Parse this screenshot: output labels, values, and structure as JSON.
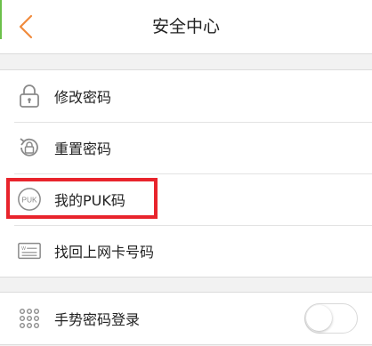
{
  "header": {
    "title": "安全中心",
    "back_icon": "chevron-left-icon"
  },
  "colors": {
    "accent": "#f08a3c",
    "highlight": "#e8242c",
    "icon": "#8a8a8a"
  },
  "menu": {
    "items": [
      {
        "label": "修改密码",
        "icon": "lock-icon"
      },
      {
        "label": "重置密码",
        "icon": "lock-reset-icon"
      },
      {
        "label": "我的PUK码",
        "icon": "puk-icon"
      },
      {
        "label": "找回上网卡号码",
        "icon": "sim-card-icon"
      }
    ]
  },
  "gesture": {
    "label": "手势密码登录",
    "icon": "keypad-icon",
    "enabled": false
  }
}
